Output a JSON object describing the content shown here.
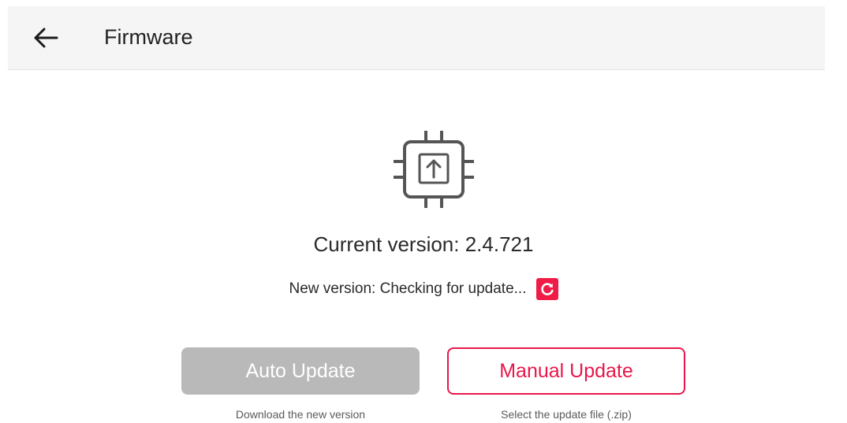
{
  "header": {
    "title": "Firmware",
    "back_icon": "arrow-left-icon"
  },
  "main": {
    "icon": "chip-upload-icon",
    "current_version_label": "Current version: 2.4.721",
    "new_version_label": "New version: Checking for update...",
    "refresh_icon": "refresh-icon"
  },
  "buttons": {
    "auto_update_label": "Auto Update",
    "auto_update_hint": "Download the new version",
    "manual_update_label": "Manual Update",
    "manual_update_hint": "Select the update file (.zip)"
  },
  "colors": {
    "accent": "#e8174a",
    "disabled_button": "#b9b9b9",
    "header_bg": "#f5f5f5"
  }
}
